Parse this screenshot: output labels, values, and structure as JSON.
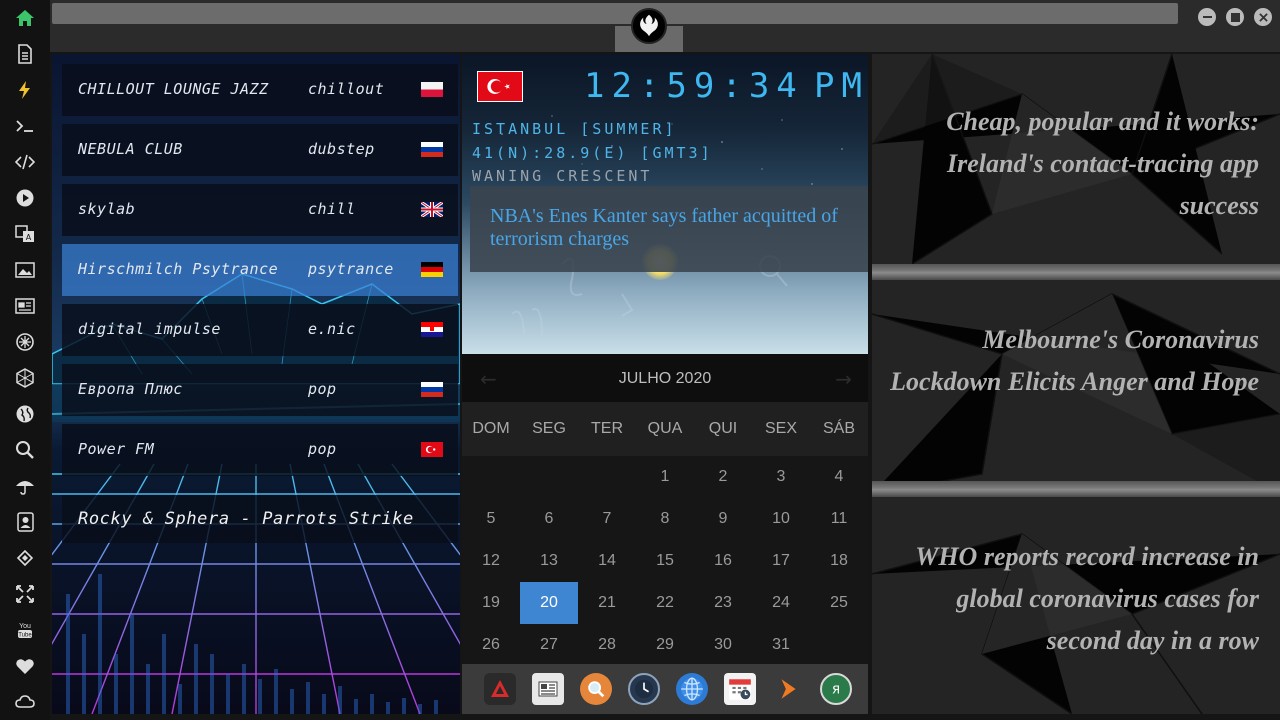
{
  "sidebar": {
    "icons": [
      "home-icon",
      "document-icon",
      "lightning-icon",
      "terminal-icon",
      "code-icon",
      "play-icon",
      "translate-icon",
      "image-icon",
      "news-icon",
      "settings-wheel-icon",
      "hexagon-icon",
      "globe-icon",
      "search-icon",
      "umbrella-icon",
      "contacts-icon",
      "network-icon",
      "fullscreen-icon",
      "youtube-icon",
      "heart-icon",
      "cloud-icon"
    ],
    "accent": "#3cc46b"
  },
  "radio": {
    "stations": [
      {
        "name": "CHILLOUT LOUNGE JAZZ",
        "genre": "chillout",
        "flag": "poland"
      },
      {
        "name": "NEBULA CLUB",
        "genre": "dubstep",
        "flag": "russia"
      },
      {
        "name": "skylab",
        "genre": "chill",
        "flag": "uk"
      },
      {
        "name": "Hirschmilch Psytrance",
        "genre": "psytrance",
        "flag": "germany"
      },
      {
        "name": "digital impulse",
        "genre": "e.nic",
        "flag": "croatia"
      },
      {
        "name": "Европа Плюс",
        "genre": "pop",
        "flag": "russia"
      },
      {
        "name": "Power FM",
        "genre": "pop",
        "flag": "turkey"
      }
    ],
    "active_index": 3,
    "now_playing": "Rocky & Sphera - Parrots Strike"
  },
  "clock": {
    "time": "12:59:34",
    "ampm": "PM",
    "location": "ISTANBUL [SUMMER]",
    "coords": "41(N):28.9(E) [GMT3]",
    "moon": "WANING CRESCENT",
    "flag": "turkey",
    "color": "#3fb7f0"
  },
  "headline": "NBA's Enes Kanter says father acquitted of terrorism charges",
  "calendar": {
    "title": "JULHO 2020",
    "weekdays": [
      "DOM",
      "SEG",
      "TER",
      "QUA",
      "QUI",
      "SEX",
      "SÁB"
    ],
    "weeks": [
      [
        "",
        "",
        "",
        "1",
        "2",
        "3",
        "4"
      ],
      [
        "5",
        "6",
        "7",
        "8",
        "9",
        "10",
        "11"
      ],
      [
        "12",
        "13",
        "14",
        "15",
        "16",
        "17",
        "18"
      ],
      [
        "19",
        "20",
        "21",
        "22",
        "23",
        "24",
        "25"
      ],
      [
        "26",
        "27",
        "28",
        "29",
        "30",
        "31",
        ""
      ]
    ],
    "today": "20",
    "today_color": "#3f86d2"
  },
  "dock": {
    "apps": [
      "ares-icon",
      "newspaper-icon",
      "search-icon",
      "clock-icon",
      "globe-icon",
      "calendar-icon",
      "arrow-icon",
      "yandex-icon"
    ]
  },
  "news": {
    "items": [
      "Cheap, popular and it works: Ireland's contact-tracing app success",
      "Melbourne's Coronavirus Lockdown Elicits Anger and Hope",
      "WHO reports record increase in global coronavirus cases for second day in a row"
    ]
  }
}
